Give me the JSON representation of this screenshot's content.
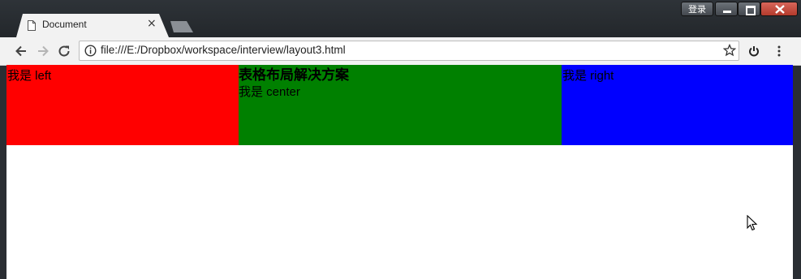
{
  "window": {
    "controls": {
      "login_label": "登录"
    }
  },
  "tab": {
    "title": "Document",
    "close_glyph": "×"
  },
  "toolbar": {
    "url": "file:///E:/Dropbox/workspace/interview/layout3.html"
  },
  "page": {
    "left": {
      "text": "我是 left",
      "color": "#ff0000"
    },
    "center": {
      "heading": "表格布局解决方案",
      "text": "我是 center",
      "color": "#008000"
    },
    "right": {
      "text": "我是 right",
      "color": "#0000ff"
    }
  },
  "icons": [
    "document-icon",
    "back-arrow-icon",
    "forward-arrow-icon",
    "reload-icon",
    "info-icon",
    "star-icon",
    "power-icon",
    "more-vert-icon",
    "mouse-cursor-icon"
  ]
}
